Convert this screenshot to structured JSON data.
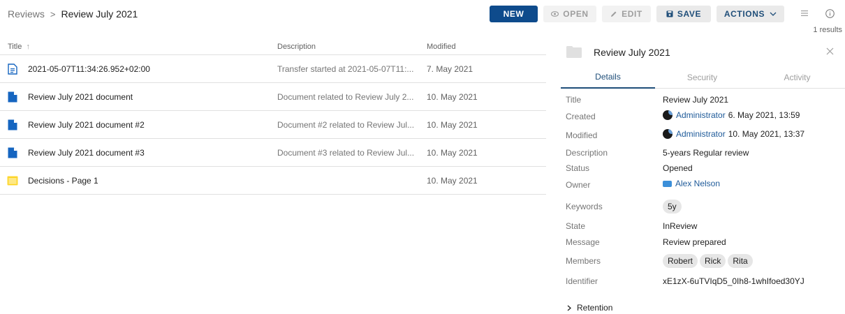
{
  "breadcrumb": {
    "parent": "Reviews",
    "separator": ">",
    "current": "Review July 2021"
  },
  "toolbar": {
    "new_label": "NEW",
    "open_label": "OPEN",
    "edit_label": "EDIT",
    "save_label": "SAVE",
    "actions_label": "ACTIONS",
    "results": "1 results"
  },
  "list": {
    "columns": {
      "title": "Title",
      "title_sort": "↑",
      "description": "Description",
      "modified": "Modified"
    },
    "rows": [
      {
        "icon": "text-document-icon",
        "title": "2021-05-07T11:34:26.952+02:00",
        "description": "Transfer started at 2021-05-07T11:...",
        "modified": "7. May 2021"
      },
      {
        "icon": "blue-document-icon",
        "title": "Review July 2021 document",
        "description": "Document related to Review July 2...",
        "modified": "10. May 2021"
      },
      {
        "icon": "blue-document-icon",
        "title": "Review July 2021 document #2",
        "description": "Document #2 related to Review Jul...",
        "modified": "10. May 2021"
      },
      {
        "icon": "blue-document-icon",
        "title": "Review July 2021 document #3",
        "description": "Document #3 related to Review Jul...",
        "modified": "10. May 2021"
      },
      {
        "icon": "yellow-page-icon",
        "title": "Decisions - Page 1",
        "description": "",
        "modified": "10. May 2021"
      }
    ]
  },
  "panel": {
    "title": "Review July 2021",
    "tabs": [
      "Details",
      "Security",
      "Activity"
    ],
    "props": {
      "title": {
        "label": "Title",
        "value": "Review July 2021"
      },
      "created": {
        "label": "Created",
        "user": "Administrator",
        "date": "6. May 2021, 13:59"
      },
      "modified": {
        "label": "Modified",
        "user": "Administrator",
        "date": "10. May 2021, 13:37"
      },
      "description": {
        "label": "Description",
        "value": "5-years Regular review"
      },
      "status": {
        "label": "Status",
        "value": "Opened"
      },
      "owner": {
        "label": "Owner",
        "value": "Alex Nelson"
      },
      "keywords": {
        "label": "Keywords",
        "values": [
          "5y"
        ]
      },
      "state": {
        "label": "State",
        "value": "InReview"
      },
      "message": {
        "label": "Message",
        "value": "Review prepared"
      },
      "members": {
        "label": "Members",
        "values": [
          "Robert",
          "Rick",
          "Rita"
        ]
      },
      "identifier": {
        "label": "Identifier",
        "value": "xE1zX-6uTVIqD5_0Ih8-1whIfoed30YJ"
      }
    },
    "retention_label": "Retention"
  },
  "colors": {
    "primary": "#0e4b8c",
    "link": "#1e5a99",
    "doc_blue": "#1565c0",
    "page_yellow": "#fdd835"
  }
}
